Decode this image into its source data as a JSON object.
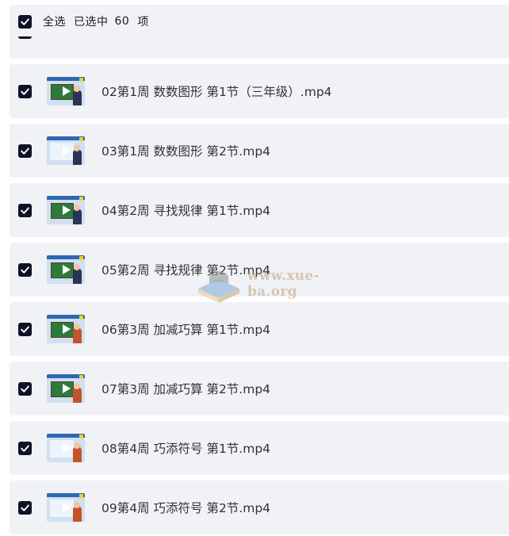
{
  "selection_bar": {
    "select_all_label": "全选",
    "selected_prefix": "已选中",
    "selected_count": "60",
    "selected_suffix": "项"
  },
  "files": [
    {
      "name": "02第1周 数数图形 第1节（三年级）.mp4",
      "thumb": "green-board-blue",
      "checked": true
    },
    {
      "name": "03第1周 数数图形 第2节.mp4",
      "thumb": "paper-blue",
      "checked": true
    },
    {
      "name": "04第2周 寻找规律 第1节.mp4",
      "thumb": "green-board-blue",
      "checked": true
    },
    {
      "name": "05第2周 寻找规律 第2节.mp4",
      "thumb": "green-board-blue",
      "checked": true
    },
    {
      "name": "06第3周 加减巧算 第1节.mp4",
      "thumb": "green-board-orange",
      "checked": true
    },
    {
      "name": "07第3周 加减巧算 第2节.mp4",
      "thumb": "green-board-orange",
      "checked": true
    },
    {
      "name": "08第4周 巧添符号 第1节.mp4",
      "thumb": "paper-orange",
      "checked": true
    },
    {
      "name": "09第4周 巧添符号 第2节.mp4",
      "thumb": "paper-orange",
      "checked": true
    }
  ],
  "watermark": {
    "text": "www.xue-ba.org"
  },
  "colors": {
    "row_bg": "#f1f2f5",
    "checkbox": "#0f1226",
    "text": "#333333"
  }
}
